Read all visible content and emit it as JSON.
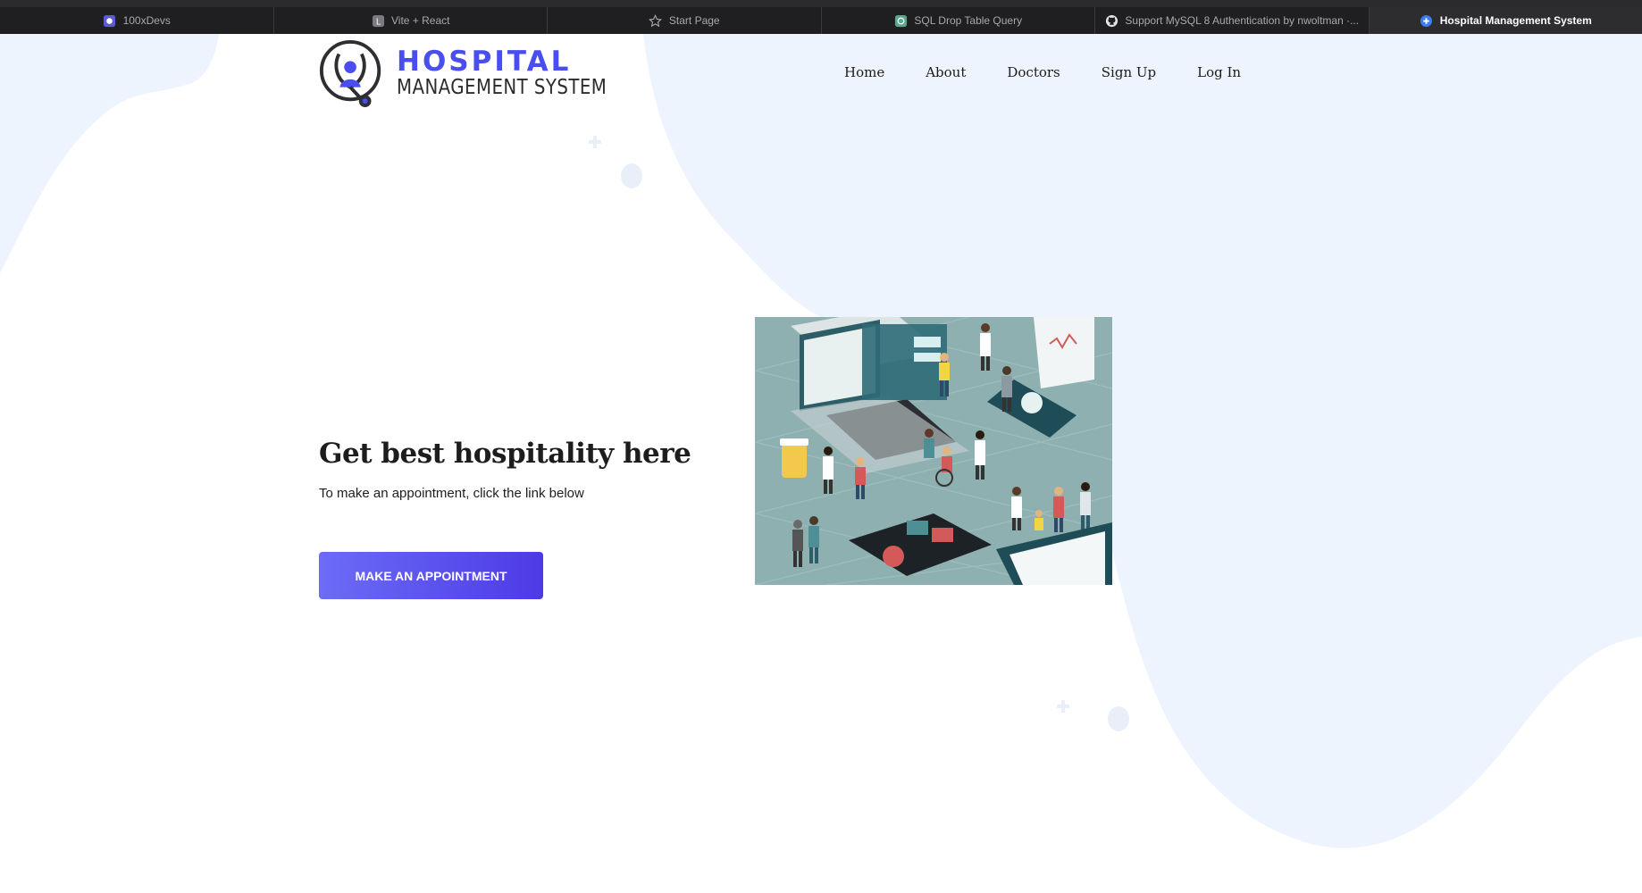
{
  "browser": {
    "tabs": [
      {
        "title": "100xDevs",
        "icon": "100xdevs-icon",
        "active": false
      },
      {
        "title": "Vite + React",
        "icon": "letter-l-icon",
        "active": false
      },
      {
        "title": "Start Page",
        "icon": "star-icon",
        "active": false
      },
      {
        "title": "SQL Drop Table Query",
        "icon": "chatgpt-icon",
        "active": false
      },
      {
        "title": "Support MySQL 8 Authentication by nwoltman ·...",
        "icon": "github-icon",
        "active": false
      },
      {
        "title": "Hospital Management System",
        "icon": "hospital-cross-icon",
        "active": true
      }
    ]
  },
  "header": {
    "logo": {
      "title": "HOSPITAL",
      "subtitle": "MANAGEMENT SYSTEM",
      "icon": "stethoscope-doctor-icon"
    },
    "nav": [
      "Home",
      "About",
      "Doctors",
      "Sign Up",
      "Log In"
    ]
  },
  "hero": {
    "title": "Get best hospitality here",
    "subtitle": "To make an appointment, click the link below",
    "cta": "MAKE AN APPOINTMENT",
    "image": "isometric-healthcare-illustration"
  },
  "colors": {
    "accent": "#4a4ef0",
    "cta_gradient_start": "#6c6cf7",
    "cta_gradient_end": "#4d3ae6",
    "blob": "#eef4fd",
    "tabbar": "#1f1f21"
  }
}
